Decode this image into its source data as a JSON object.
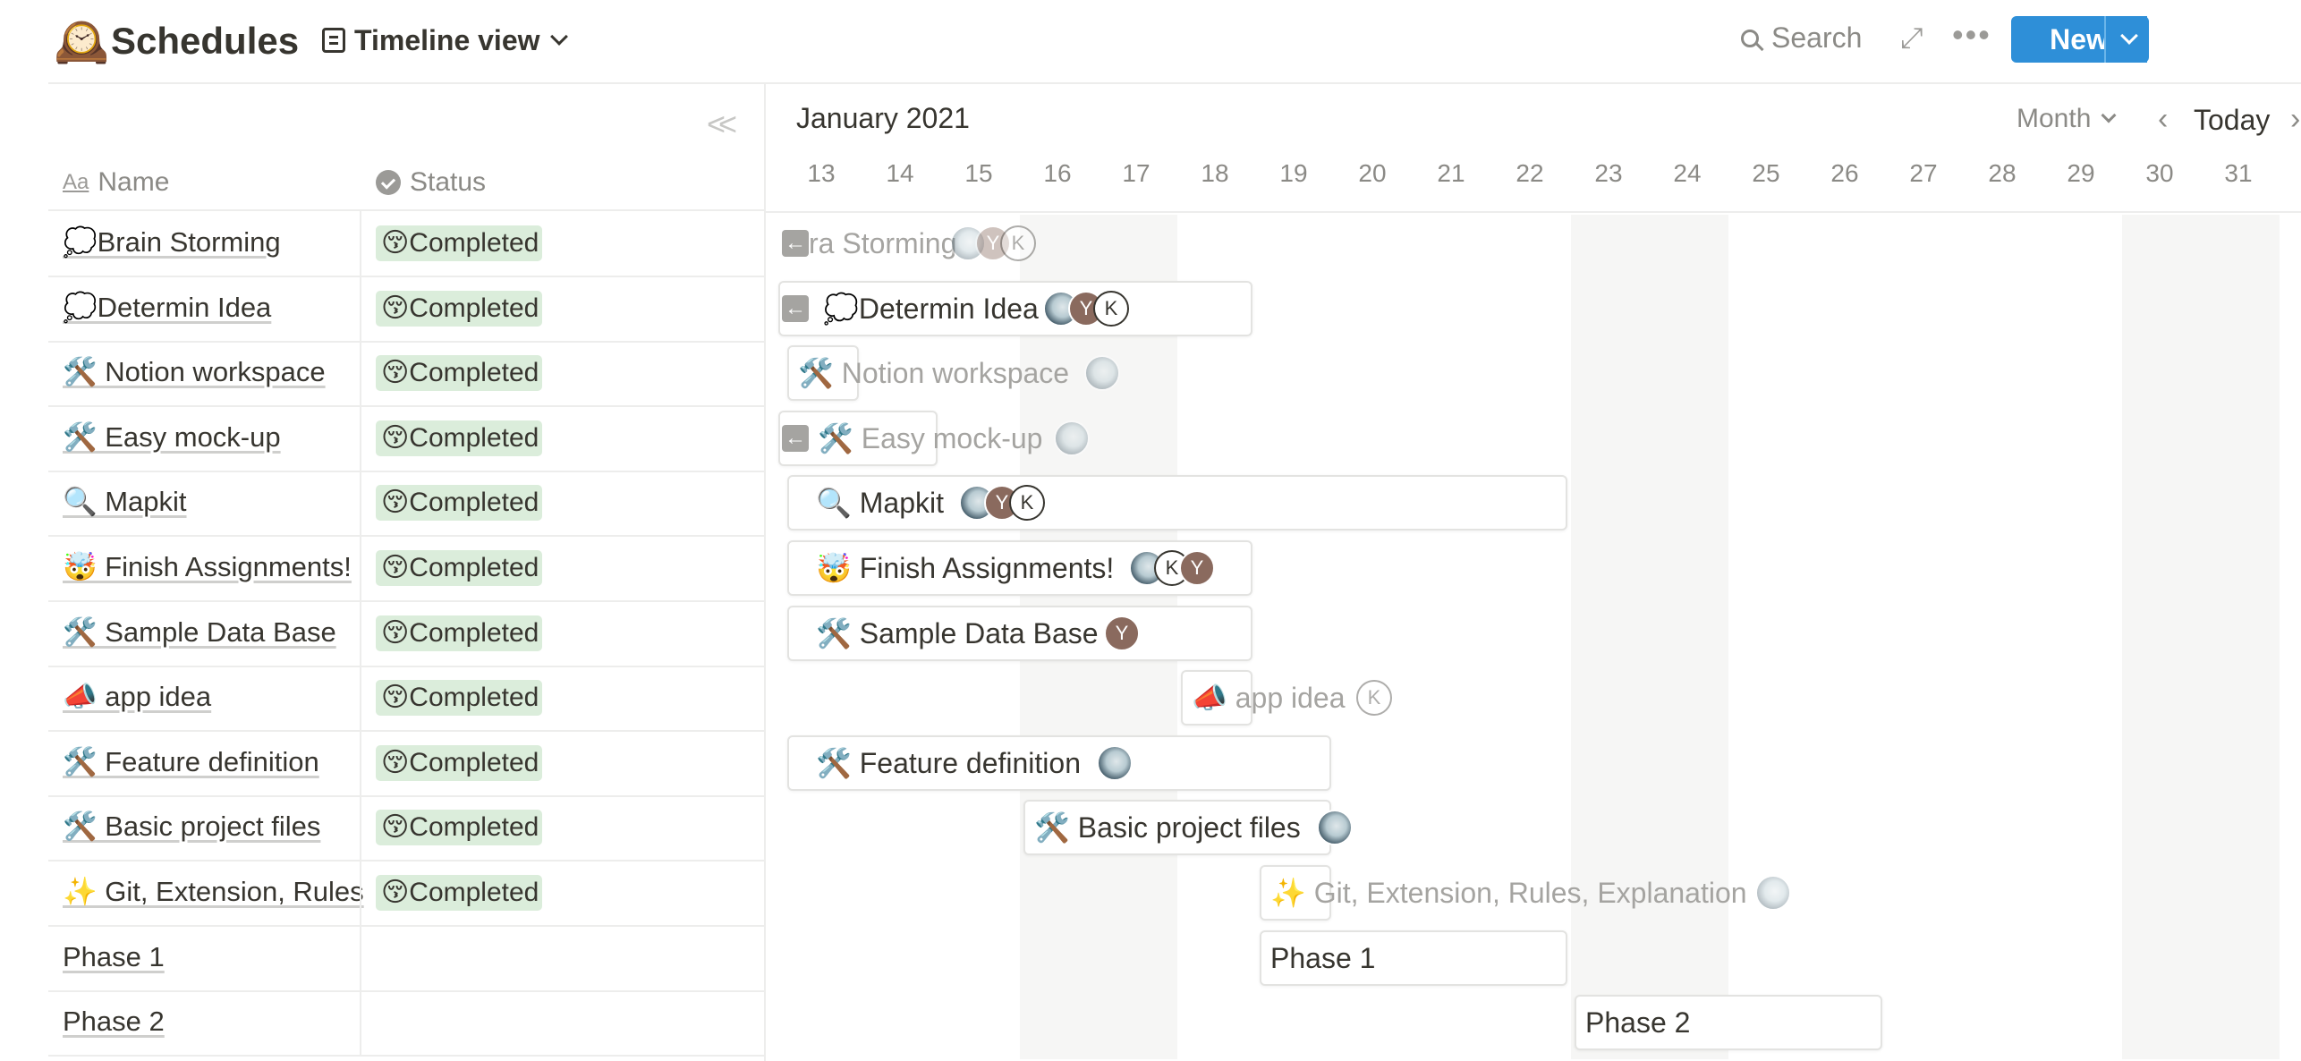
{
  "header": {
    "icon": "🕰️",
    "title": "Schedules",
    "view_label": "Timeline view",
    "search_label": "Search",
    "new_label": "New",
    "more": "•••",
    "expand": "⤢"
  },
  "table": {
    "collapse_icon": "<<",
    "col_name_icon": "Aa",
    "col_name": "Name",
    "col_status": "Status",
    "rows": [
      {
        "name": "💭Brain Storming",
        "status": "😚Completed"
      },
      {
        "name": "💭Determin Idea",
        "status": "😚Completed"
      },
      {
        "name": "🛠️ Notion workspace",
        "status": "😚Completed"
      },
      {
        "name": "🛠️ Easy mock-up",
        "status": "😚Completed"
      },
      {
        "name": "🔍 Mapkit",
        "status": "😚Completed"
      },
      {
        "name": "🤯 Finish Assignments!",
        "status": "😚Completed"
      },
      {
        "name": "🛠️ Sample Data Base",
        "status": "😚Completed"
      },
      {
        "name": "📣 app idea",
        "status": "😚Completed"
      },
      {
        "name": "🛠️ Feature definition",
        "status": "😚Completed"
      },
      {
        "name": "🛠️ Basic project files",
        "status": "😚Completed"
      },
      {
        "name": "✨ Git, Extension, Rules",
        "status": "😚Completed"
      },
      {
        "name": "Phase 1",
        "status": ""
      },
      {
        "name": "Phase 2",
        "status": ""
      }
    ]
  },
  "timeline": {
    "month_label": "January 2021",
    "scale_label": "Month",
    "today_label": "Today",
    "days": [
      "13",
      "14",
      "15",
      "16",
      "17",
      "18",
      "19",
      "20",
      "21",
      "22",
      "23",
      "24",
      "25",
      "26",
      "27",
      "28",
      "29",
      "30",
      "31"
    ],
    "bars": [
      {
        "text": "ra Storming",
        "avatars": [
          "photo",
          "Y",
          "K"
        ]
      },
      {
        "text": "💭Determin Idea",
        "avatars": [
          "photo",
          "Y",
          "K"
        ]
      },
      {
        "text": "🛠️ Notion workspace",
        "avatars": [
          "photo"
        ]
      },
      {
        "text": "🛠️ Easy mock-up",
        "avatars": [
          "photo"
        ]
      },
      {
        "text": "🔍 Mapkit",
        "avatars": [
          "photo",
          "Y",
          "K"
        ]
      },
      {
        "text": "🤯 Finish Assignments!",
        "avatars": [
          "photo",
          "K",
          "Y"
        ]
      },
      {
        "text": "🛠️ Sample Data Base",
        "avatars": [
          "Y"
        ]
      },
      {
        "text": "📣 app idea",
        "avatars": [
          "K"
        ]
      },
      {
        "text": "🛠️ Feature definition",
        "avatars": [
          "photo"
        ]
      },
      {
        "text": "🛠️ Basic project files",
        "avatars": [
          "photo"
        ]
      },
      {
        "text": "✨ Git, Extension, Rules, Explanation",
        "avatars": [
          "photo"
        ]
      },
      {
        "text": "Phase 1",
        "avatars": []
      },
      {
        "text": "Phase 2",
        "avatars": []
      }
    ]
  }
}
